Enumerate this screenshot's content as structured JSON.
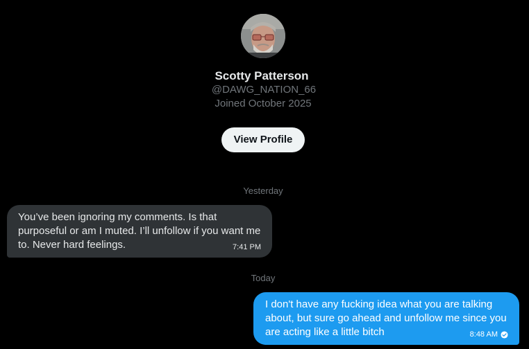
{
  "profile": {
    "name": "Scotty Patterson",
    "handle": "@DAWG_NATION_66",
    "joined": "Joined October 2025",
    "view_profile_label": "View Profile"
  },
  "conversation": {
    "dividers": [
      "Yesterday",
      "Today"
    ],
    "messages": [
      {
        "direction": "incoming",
        "text": "You’ve been ignoring my comments. Is that purposeful or am I muted. I’ll unfollow if you want me to. Never hard feelings.",
        "time": "7:41 PM"
      },
      {
        "direction": "outgoing",
        "text": "I don't have any fucking idea what you are talking about, but sure go ahead and unfollow me since you are acting like a little bitch",
        "time": "8:48 AM",
        "status_icon": "read-check-icon"
      }
    ]
  },
  "colors": {
    "background": "#000000",
    "incoming_bubble": "#2f3336",
    "outgoing_bubble": "#1d9bf0",
    "muted_text": "#71767b",
    "button_bg": "#eff3f4"
  }
}
